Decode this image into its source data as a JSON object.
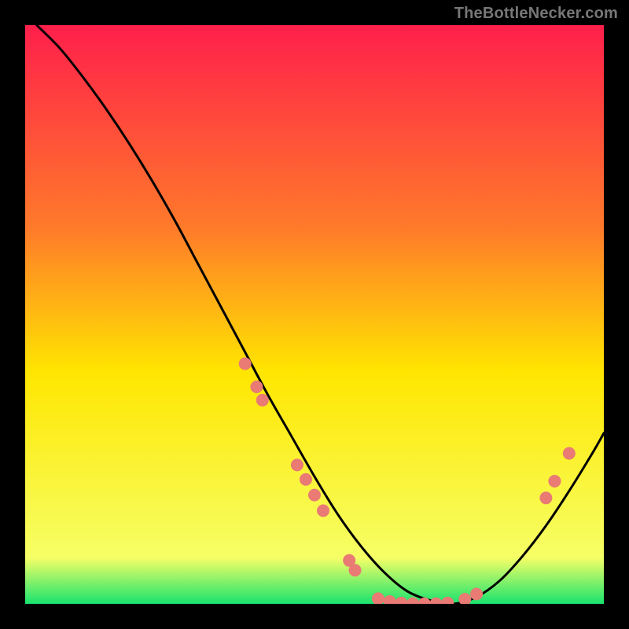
{
  "watermark": "TheBottleNecker.com",
  "chart_data": {
    "type": "line",
    "title": "",
    "xlabel": "",
    "ylabel": "",
    "xlim": [
      0,
      100
    ],
    "ylim": [
      0,
      100
    ],
    "gradient_stops": [
      {
        "offset": 0,
        "color": "#ff1f4b"
      },
      {
        "offset": 35,
        "color": "#ff7a2a"
      },
      {
        "offset": 60,
        "color": "#ffe600"
      },
      {
        "offset": 92,
        "color": "#f6ff66"
      },
      {
        "offset": 100,
        "color": "#19e36e"
      }
    ],
    "series": [
      {
        "name": "bottleneck-curve",
        "x": [
          2,
          6,
          10,
          14,
          18,
          22,
          26,
          30,
          34,
          38,
          42,
          46,
          50,
          54,
          58,
          62,
          66,
          70,
          74,
          78,
          82,
          86,
          90,
          94,
          98,
          100
        ],
        "y": [
          100,
          96,
          91,
          85.5,
          79.5,
          73,
          66,
          58.5,
          51,
          43.5,
          36,
          29,
          22,
          15.5,
          10,
          5.5,
          2.2,
          0.6,
          0,
          1.2,
          4,
          8.3,
          13.5,
          19.5,
          26,
          29.5
        ]
      }
    ],
    "markers": {
      "name": "data-points",
      "color": "#e97a74",
      "radius": 8,
      "points": [
        {
          "x": 38,
          "y": 41.5
        },
        {
          "x": 40,
          "y": 37.5
        },
        {
          "x": 41,
          "y": 35.2
        },
        {
          "x": 47,
          "y": 24
        },
        {
          "x": 48.5,
          "y": 21.5
        },
        {
          "x": 50,
          "y": 18.8
        },
        {
          "x": 51.5,
          "y": 16.1
        },
        {
          "x": 56,
          "y": 7.5
        },
        {
          "x": 57,
          "y": 5.8
        },
        {
          "x": 61,
          "y": 0.9
        },
        {
          "x": 63,
          "y": 0.4
        },
        {
          "x": 65,
          "y": 0.15
        },
        {
          "x": 67,
          "y": 0.05
        },
        {
          "x": 69,
          "y": 0.02
        },
        {
          "x": 71,
          "y": 0.03
        },
        {
          "x": 73,
          "y": 0.15
        },
        {
          "x": 76,
          "y": 0.8
        },
        {
          "x": 78,
          "y": 1.7
        },
        {
          "x": 90,
          "y": 18.3
        },
        {
          "x": 91.5,
          "y": 21.2
        },
        {
          "x": 94,
          "y": 26
        }
      ]
    }
  }
}
